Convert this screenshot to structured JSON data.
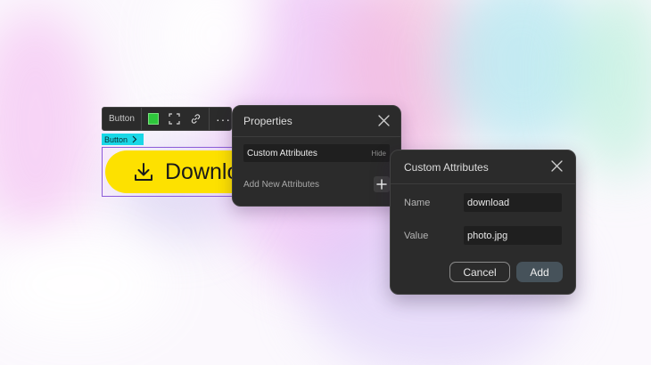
{
  "toolbar": {
    "element_type": "Button",
    "color_swatch": "#2ec73c",
    "icons": [
      "color-swatch-icon",
      "expand-icon",
      "link-icon",
      "more-icon"
    ],
    "more": "···"
  },
  "element_tag": {
    "label": "Button",
    "color": "#19d7e6"
  },
  "canvas_button": {
    "label": "Download",
    "background": "#fde100",
    "icon": "download-icon"
  },
  "properties_panel": {
    "title": "Properties",
    "section_title": "Custom Attributes",
    "section_toggle": "Hide",
    "add_label": "Add New Attributes"
  },
  "attributes_dialog": {
    "title": "Custom Attributes",
    "name_label": "Name",
    "name_value": "download",
    "value_label": "Value",
    "value_value": "photo.jpg",
    "cancel_label": "Cancel",
    "add_label": "Add"
  }
}
